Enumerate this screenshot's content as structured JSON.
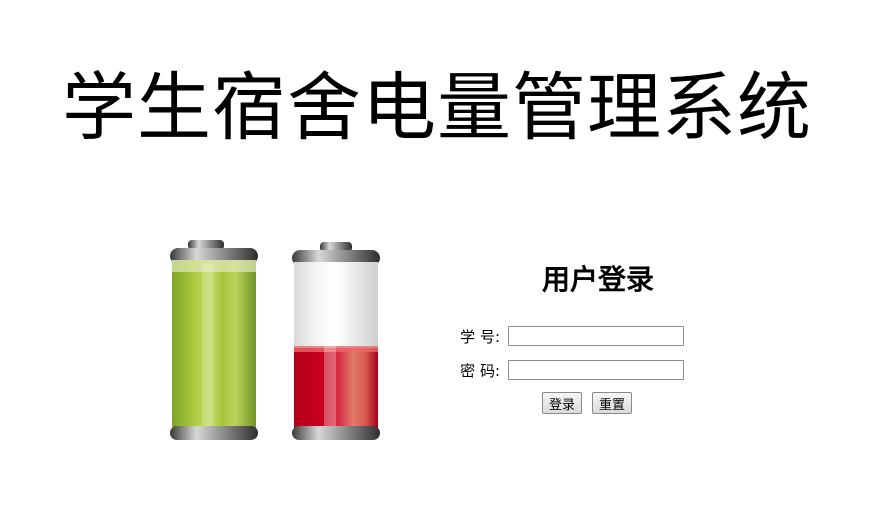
{
  "page": {
    "title": "学生宿舍电量管理系统"
  },
  "illustration": {
    "icon": "battery-levels-image",
    "full_battery_color": "#9dc33a",
    "low_battery_color": "#c4001d",
    "low_battery_level": 0.38,
    "full_battery_level": 1.0
  },
  "login": {
    "title": "用户登录",
    "student_id_label": "学 号:",
    "student_id_value": "",
    "password_label": "密 码:",
    "password_value": "",
    "login_button": "登录",
    "reset_button": "重置"
  }
}
